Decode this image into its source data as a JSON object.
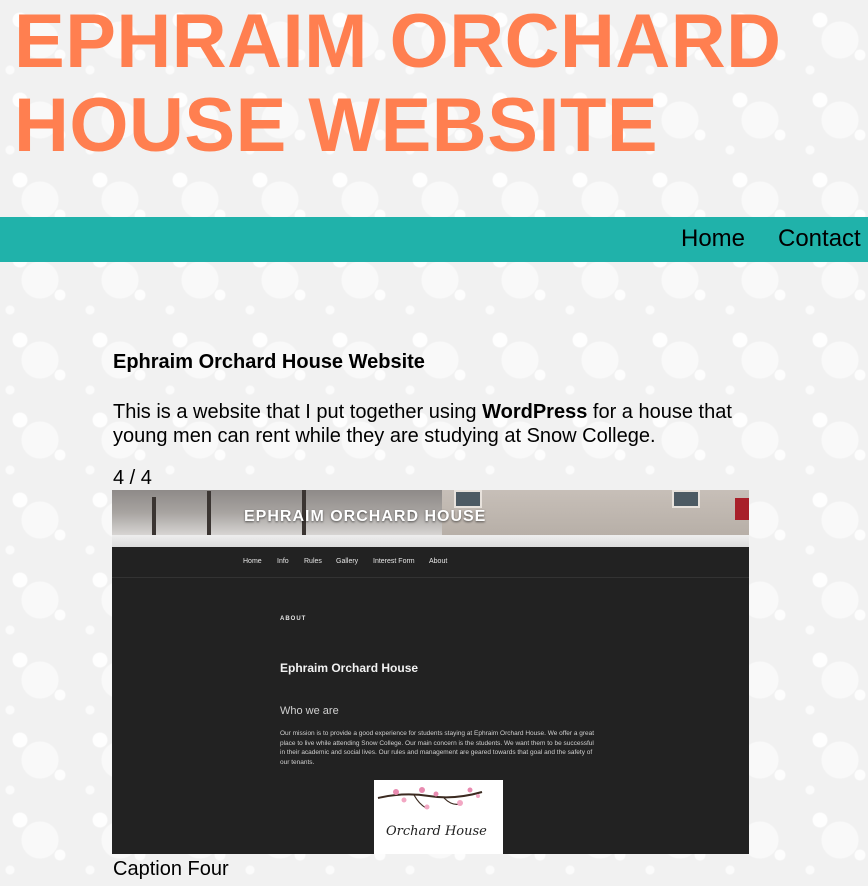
{
  "header": {
    "site_title": "EPHRAIM ORCHARD HOUSE WEBSITE"
  },
  "nav": {
    "items": [
      {
        "label": "Home"
      },
      {
        "label": "Contact"
      }
    ]
  },
  "project": {
    "title": "Ephraim Orchard House Website",
    "desc_before": "This is a website that I put together using ",
    "desc_bold": "WordPress",
    "desc_after": " for a house that young men can rent while they are studying at Snow College."
  },
  "slideshow": {
    "counter": "4 / 4",
    "caption": "Caption Four",
    "slide": {
      "site_title": "EPHRAIM ORCHARD HOUSE",
      "nav_items": [
        "Home",
        "Info",
        "Rules",
        "Gallery",
        "Interest Form",
        "About"
      ],
      "section_label": "ABOUT",
      "heading": "Ephraim Orchard House",
      "subheading": "Who we are",
      "body": "Our mission is to provide a good experience for students staying at Ephraim Orchard House. We offer a great place to live while attending Snow College. Our main concern is the students. We want them to be successful in their academic and social lives. Our rules and management are geared towards that goal and the safety of our tenants.",
      "logo_text": "Orchard House"
    }
  },
  "colors": {
    "title": "#ff7f50",
    "navbar": "#20b2aa",
    "slide_bg": "#222222"
  }
}
